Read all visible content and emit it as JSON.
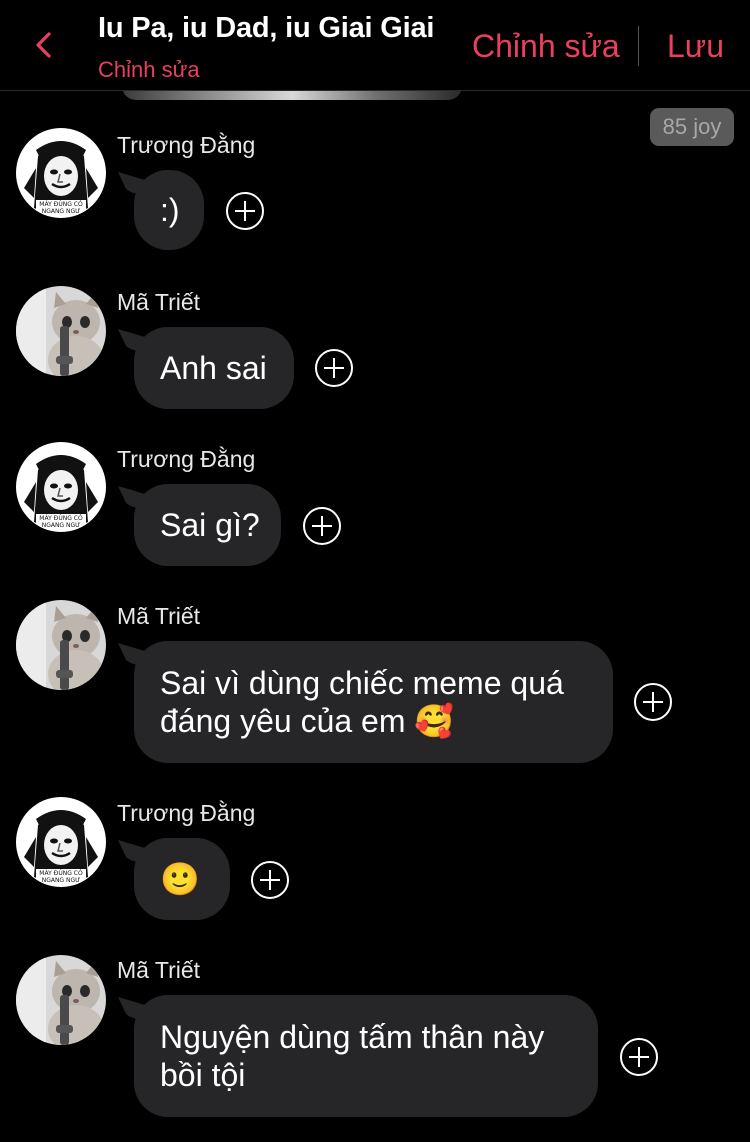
{
  "header": {
    "title": "Iu Pa, iu Dad, iu Giai Giai",
    "subtitle": "Chỉnh sửa",
    "edit_label": "Chỉnh sửa",
    "save_label": "Lưu",
    "back_icon": "chevron-left-icon",
    "accent_color": "#ea3f5f"
  },
  "joy_badge": "85 joy",
  "messages": [
    {
      "sender": "Trương Đằng",
      "avatar": "meme-face-avatar",
      "text": ":)"
    },
    {
      "sender": "Mã Triết",
      "avatar": "cat-avatar",
      "text": "Anh sai"
    },
    {
      "sender": "Trương Đằng",
      "avatar": "meme-face-avatar",
      "text": "Sai gì?"
    },
    {
      "sender": "Mã Triết",
      "avatar": "cat-avatar",
      "text": "Sai vì dùng chiếc meme quá\nđáng yêu của em 🥰"
    },
    {
      "sender": "Trương Đằng",
      "avatar": "meme-face-avatar",
      "text": "🙂"
    },
    {
      "sender": "Mã Triết",
      "avatar": "cat-avatar",
      "text": "Nguyện dùng tấm thân này\nbồi tội"
    }
  ],
  "avatar_caption": "MÀY ĐÙNG CÓ NGANG NGƯ",
  "colors": {
    "background": "#000000",
    "bubble": "#262628",
    "badge": "#5a5a5a"
  }
}
